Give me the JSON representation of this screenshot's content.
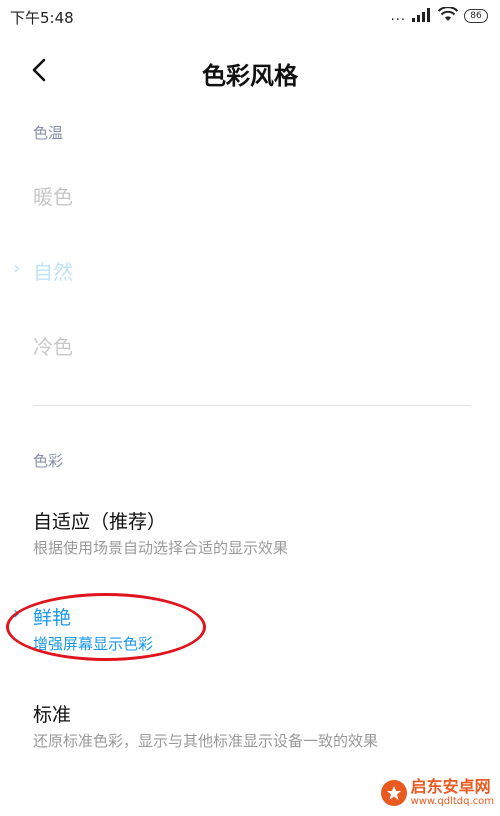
{
  "status_bar": {
    "time": "下午5:48",
    "signal": "...",
    "battery": "86"
  },
  "header": {
    "title": "色彩风格"
  },
  "color_temperature": {
    "label": "色温",
    "options": [
      {
        "label": "暖色",
        "selected": false
      },
      {
        "label": "自然",
        "selected": true
      },
      {
        "label": "冷色",
        "selected": false
      }
    ]
  },
  "color": {
    "label": "色彩",
    "options": [
      {
        "title": "自适应（推荐）",
        "subtitle": "根据使用场景自动选择合适的显示效果",
        "selected": false
      },
      {
        "title": "鲜艳",
        "subtitle": "增强屏幕显示色彩",
        "selected": true
      },
      {
        "title": "标准",
        "subtitle": "还原标准色彩，显示与其他标准显示设备一致的效果",
        "selected": false
      }
    ]
  },
  "check_mark": "›",
  "watermark": {
    "name": "启东安卓网",
    "url": "www.qdltdq.com"
  },
  "colors": {
    "accent": "#1b99e8",
    "accent_faded": "#bfe3f7",
    "annotation": "#e0141d",
    "watermark": "#e85a20"
  }
}
